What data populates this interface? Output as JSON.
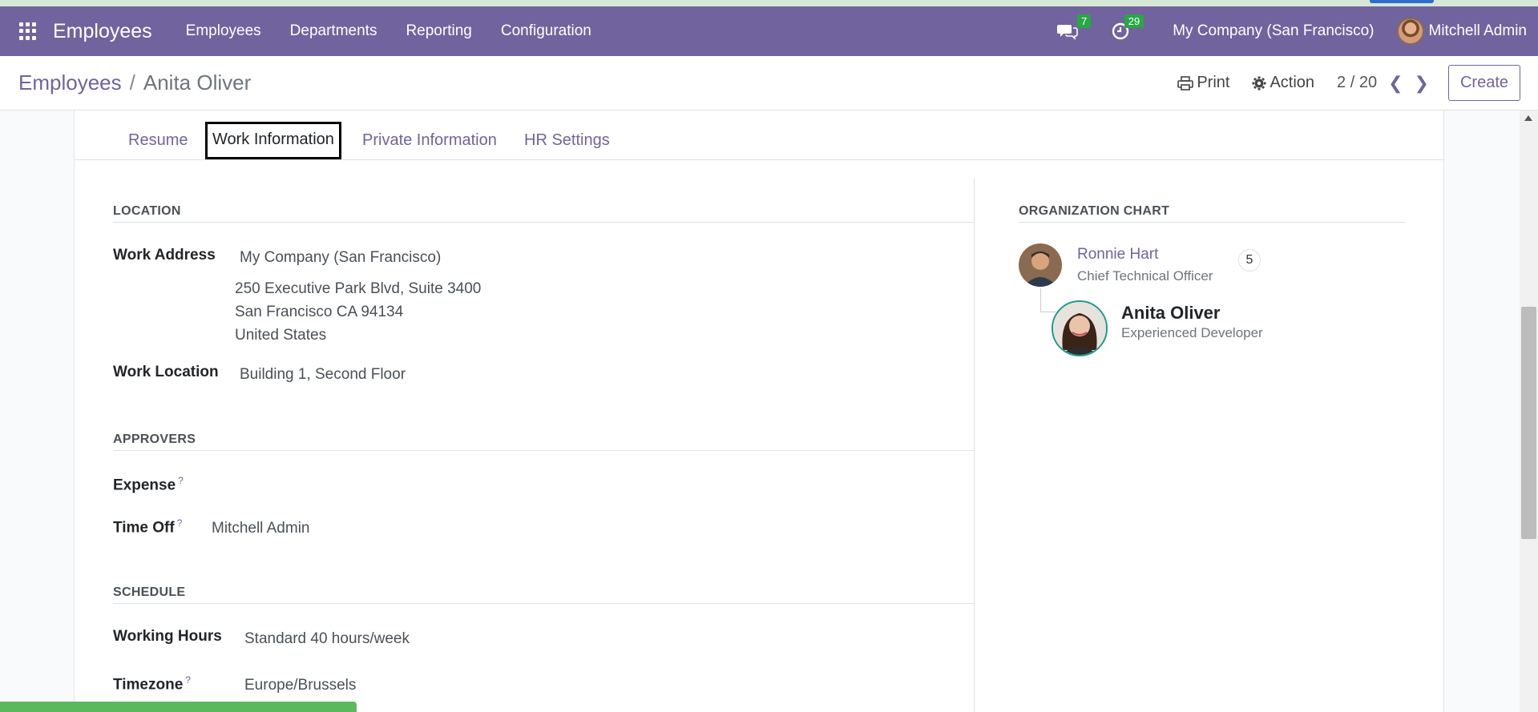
{
  "navbar": {
    "app_title": "Employees",
    "menu": [
      "Employees",
      "Departments",
      "Reporting",
      "Configuration"
    ],
    "messages_count": "7",
    "activities_count": "29",
    "company": "My Company (San Francisco)",
    "user": "Mitchell Admin",
    "accent_color": "#71639e"
  },
  "control": {
    "breadcrumb_parent": "Employees",
    "breadcrumb_sep": "/",
    "breadcrumb_current": "Anita Oliver",
    "print_label": "Print",
    "action_label": "Action",
    "pager": "2 / 20",
    "create_label": "Create"
  },
  "tabs": [
    "Resume",
    "Work Information",
    "Private Information",
    "HR Settings"
  ],
  "location": {
    "title": "LOCATION",
    "work_address_label": "Work Address",
    "work_address_name": "My Company (San Francisco)",
    "address_line1": "250 Executive Park Blvd, Suite 3400",
    "address_line2": "San Francisco CA 94134",
    "address_line3": "United States",
    "work_location_label": "Work Location",
    "work_location": "Building 1, Second Floor"
  },
  "approvers": {
    "title": "APPROVERS",
    "expense_label": "Expense",
    "expense_help": "?",
    "time_off_label": "Time Off",
    "time_off_help": "?",
    "time_off_value": "Mitchell Admin"
  },
  "schedule": {
    "title": "SCHEDULE",
    "working_hours_label": "Working Hours",
    "working_hours": "Standard 40 hours/week",
    "timezone_label": "Timezone",
    "timezone_help": "?",
    "timezone": "Europe/Brussels"
  },
  "org_chart": {
    "title": "ORGANIZATION CHART",
    "manager_name": "Ronnie Hart",
    "manager_title": "Chief Technical Officer",
    "manager_count": "5",
    "employee_name": "Anita Oliver",
    "employee_title": "Experienced Developer"
  }
}
